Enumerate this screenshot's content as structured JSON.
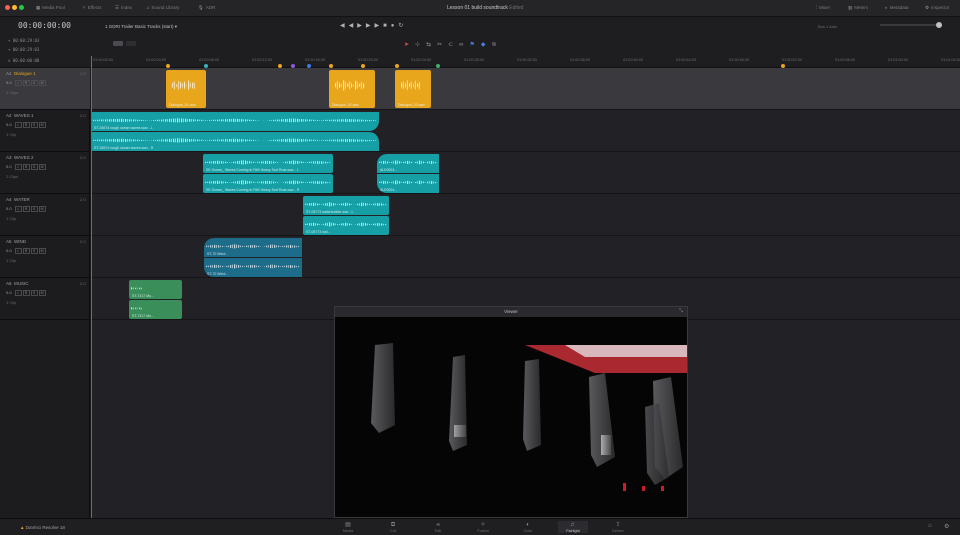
{
  "app": {
    "name": "DaVinci Resolve 18",
    "project_title": "Lesson 01 build soundtrack",
    "project_status": "Edited"
  },
  "topbar": {
    "left_items": [
      {
        "label": "Media Pool",
        "icon": "media-pool-icon"
      },
      {
        "label": "Effects",
        "icon": "effects-icon"
      },
      {
        "label": "Index",
        "icon": "index-icon"
      },
      {
        "label": "Sound Library",
        "icon": "sound-library-icon"
      },
      {
        "label": "ADR",
        "icon": "adr-icon"
      }
    ],
    "right_items": [
      {
        "label": "Mixer",
        "icon": "mixer-icon"
      },
      {
        "label": "Meters",
        "icon": "meters-icon"
      },
      {
        "label": "Metadata",
        "icon": "metadata-icon"
      },
      {
        "label": "Inspector",
        "icon": "inspector-icon"
      }
    ]
  },
  "timecode": {
    "main": "00:00:00:00",
    "sub1": "00:00:29:03",
    "sub2": "00:00:29:03",
    "sub3": "00:00:00:00"
  },
  "timeline_select": "1 GDRI Trailer Basic Tracks (start)",
  "bus_label": "Bus 1",
  "auto_label": "Auto",
  "ruler_ticks": [
    "01:00:00:00",
    "01:00:04:00",
    "01:00:08:00",
    "01:00:12:00",
    "01:00:16:00",
    "01:00:20:00",
    "01:00:24:00",
    "01:00:28:00",
    "01:00:32:00",
    "01:00:36:00",
    "01:00:40:00",
    "01:00:44:00",
    "01:00:48:00",
    "01:00:52:00",
    "01:00:56:00",
    "01:01:00:00",
    "01:01:04:00"
  ],
  "tracks": [
    {
      "id": "A1",
      "name": "Dialogue 1",
      "vol": "0.0",
      "clips_count": "3 Clips",
      "ch": "1.0"
    },
    {
      "id": "A2",
      "name": "WAVES 1",
      "vol": "0.0",
      "clips_count": "1 Clip",
      "ch": "2.0"
    },
    {
      "id": "A3",
      "name": "WAVES 2",
      "vol": "0.0",
      "clips_count": "2 Clips",
      "ch": "2.0"
    },
    {
      "id": "A4",
      "name": "WATER",
      "vol": "0.0",
      "clips_count": "1 Clip",
      "ch": "2.0"
    },
    {
      "id": "A5",
      "name": "WIND",
      "vol": "0.0",
      "clips_count": "1 Clip",
      "ch": "2.0"
    },
    {
      "id": "A6",
      "name": "MUSIC",
      "vol": "0.0",
      "clips_count": "1 Clip",
      "ch": "2.0"
    }
  ],
  "clips": {
    "a1_1": "Dialogue_01.wav",
    "a1_2": "Dialogue_02.wav",
    "a1_3": "Dialogue_03.wav",
    "a2_l": "ST-15674 rough ocean waves.wav - L",
    "a2_r": "ST-15674 rough ocean waves.wav - R",
    "a3_1l": "SE Ocean_ Waves Coming In R60 Heavy Surf Roar.wav - L",
    "a3_1r": "SE Ocean_ Waves Coming In R60 Heavy Surf Roar.wav - R",
    "a3_2l": "ALE0091...",
    "a3_2r": "ALE0091...",
    "a4_l": "ST-05773 waterbubble.wav - L",
    "a4_r": "ST-05773 wat...",
    "a5_l": "ST-70 Wind...",
    "a5_r": "ST-70 Wind...",
    "a6_l": "ST-7417 Mu...",
    "a6_r": "ST-7417 Mu..."
  },
  "viewer": {
    "title": "Viewer"
  },
  "pages": [
    {
      "label": "Media",
      "icon": "media-page-icon"
    },
    {
      "label": "Cut",
      "icon": "cut-page-icon"
    },
    {
      "label": "Edit",
      "icon": "edit-page-icon"
    },
    {
      "label": "Fusion",
      "icon": "fusion-page-icon"
    },
    {
      "label": "Color",
      "icon": "color-page-icon"
    },
    {
      "label": "Fairlight",
      "icon": "fairlight-page-icon"
    },
    {
      "label": "Deliver",
      "icon": "deliver-page-icon"
    }
  ],
  "colors": {
    "accent": "#e8a61c",
    "teal": "#16a0a6",
    "blue": "#1d6c8a",
    "green": "#3a8e5a",
    "playhead": "#e0403a"
  }
}
